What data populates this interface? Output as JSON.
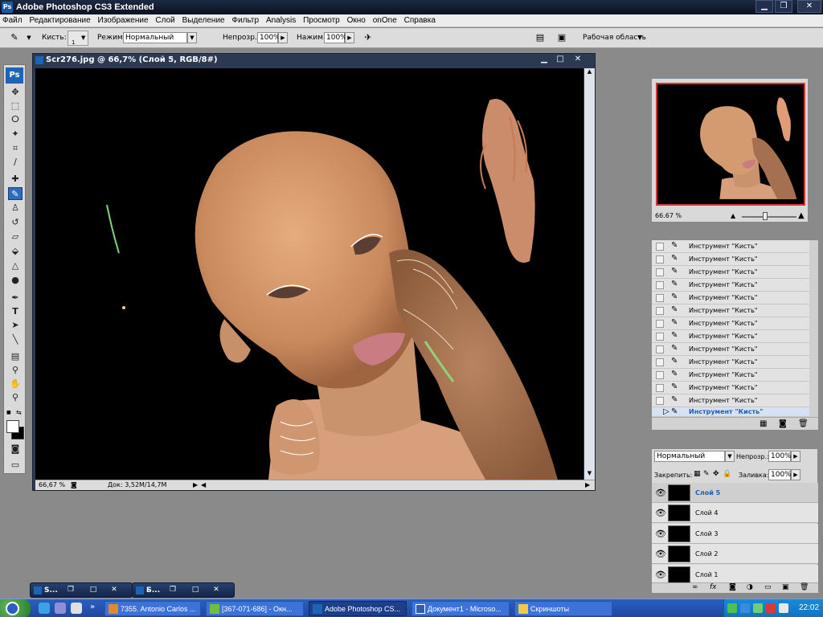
{
  "app": {
    "title": "Adobe Photoshop CS3 Extended",
    "logo": "Ps"
  },
  "menu": [
    "Файл",
    "Редактирование",
    "Изображение",
    "Слой",
    "Выделение",
    "Фильтр",
    "Analysis",
    "Просмотр",
    "Окно",
    "onOne",
    "Справка"
  ],
  "options": {
    "brushes_label": "Кисть:",
    "brush_size": "1",
    "mode_label": "Режим:",
    "mode_value": "Нормальный",
    "opacity_label": "Непрозр.:",
    "opacity_value": "100%",
    "flow_label": "Нажим:",
    "flow_value": "100%",
    "workspace_label": "Рабочая область"
  },
  "document": {
    "title": "Scr276.jpg @ 66,7% (Слой 5, RGB/8#)",
    "zoom": "66,67 %",
    "doc_info": "Док: 3,52M/14,7M"
  },
  "navigator": {
    "zoom": "66.67 %"
  },
  "history": {
    "items": [
      "Инструмент \"Кисть\"",
      "Инструмент \"Кисть\"",
      "Инструмент \"Кисть\"",
      "Инструмент \"Кисть\"",
      "Инструмент \"Кисть\"",
      "Инструмент \"Кисть\"",
      "Инструмент \"Кисть\"",
      "Инструмент \"Кисть\"",
      "Инструмент \"Кисть\"",
      "Инструмент \"Кисть\"",
      "Инструмент \"Кисть\"",
      "Инструмент \"Кисть\"",
      "Инструмент \"Кисть\"",
      "Инструмент \"Кисть\""
    ]
  },
  "layers": {
    "blend_mode": "Нормальный",
    "opacity_label": "Непрозр.:",
    "opacity_value": "100%",
    "lock_label": "Закрепить:",
    "fill_label": "Заливка:",
    "fill_value": "100%",
    "items": [
      "Слой 5",
      "Слой 4",
      "Слой 3",
      "Слой 2",
      "Слой 1"
    ]
  },
  "minimized": [
    {
      "label": "S..."
    },
    {
      "label": "Б..."
    }
  ],
  "taskbar": {
    "tasks": [
      "7355. Antonio Carlos ...",
      "[367-071-686] - Окн...",
      "Adobe Photoshop CS...",
      "Документ1 - Microso...",
      "Скриншоты"
    ],
    "clock": "22:02",
    "more": "»"
  }
}
